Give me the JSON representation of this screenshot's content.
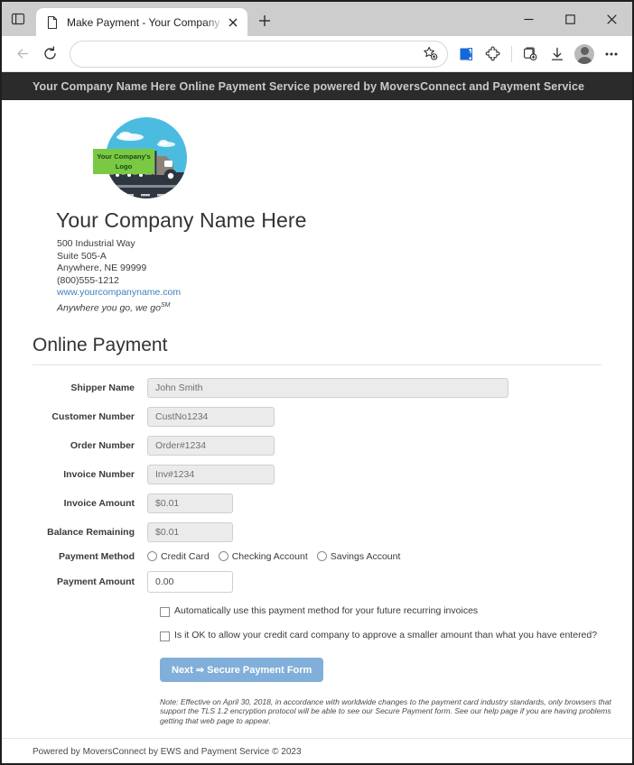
{
  "browser": {
    "tab": {
      "title": "Make Payment - Your Company N",
      "favicon_name": "page-icon",
      "close_label": "✕"
    },
    "new_tab_label": "+",
    "address_bar": {
      "value": "",
      "placeholder": ""
    },
    "window_controls": {
      "minimize": "—",
      "maximize": "☐",
      "close": "✕"
    },
    "toolbar_icons": [
      "back-icon",
      "reload-icon",
      "add-favorite-icon",
      "browser-essentials-icon",
      "extensions-icon",
      "collections-icon",
      "downloads-icon",
      "profile-avatar-icon",
      "settings-and-more-icon"
    ]
  },
  "banner": {
    "text": "Your Company Name Here Online Payment Service powered by MoversConnect and Payment Service",
    "background_color": "#2b2b2b",
    "text_color": "#c9c9c9"
  },
  "logo": {
    "placeholder_line1": "Your Company's",
    "placeholder_line2": "Logo",
    "sky_color": "#4bbcdf",
    "box_color": "#7ac943",
    "road_color": "#2f3640"
  },
  "company": {
    "name": "Your Company Name Here",
    "address_line1": "500 Industrial Way",
    "address_line2": "Suite 505-A",
    "address_line3": "Anywhere, NE 99999",
    "phone": "(800)555-1212",
    "website": "www.yourcompanyname.com",
    "tagline": "Anywhere you go, we go",
    "tagline_mark": "SM"
  },
  "page": {
    "heading": "Online Payment"
  },
  "form": {
    "fields": [
      {
        "label": "Shipper Name",
        "value": "John Smith",
        "width": "w-shipper",
        "readonly": true
      },
      {
        "label": "Customer Number",
        "value": "CustNo1234",
        "width": "w-med",
        "readonly": true
      },
      {
        "label": "Order Number",
        "value": "Order#1234",
        "width": "w-med",
        "readonly": true
      },
      {
        "label": "Invoice Number",
        "value": "Inv#1234",
        "width": "w-med",
        "readonly": true
      },
      {
        "label": "Invoice Amount",
        "value": "$0.01",
        "width": "w-small",
        "readonly": true
      },
      {
        "label": "Balance Remaining",
        "value": "$0.01",
        "width": "w-small",
        "readonly": true
      }
    ],
    "payment_method": {
      "label": "Payment Method",
      "options": [
        "Credit Card",
        "Checking Account",
        "Savings Account"
      ],
      "selected": ""
    },
    "payment_amount": {
      "label": "Payment Amount",
      "value": "0.00"
    },
    "checkboxes": [
      {
        "label": "Automatically use this payment method for your future recurring invoices",
        "checked": false
      },
      {
        "label": "Is it OK to allow your credit card company to approve a smaller amount than what you have entered?",
        "checked": false
      }
    ],
    "submit_label": "Next ⇒ Secure Payment Form",
    "submit_color": "#81afd9",
    "note": "Note: Effective on April 30, 2018, in accordance with worldwide changes to the payment card industry standards, only browsers that support the TLS 1.2 encryption protocol will be able to see our Secure Payment form.  See our help page if you are having problems getting that web page to appear."
  },
  "footer": {
    "text": "Powered by MoversConnect by EWS and Payment Service © 2023"
  }
}
